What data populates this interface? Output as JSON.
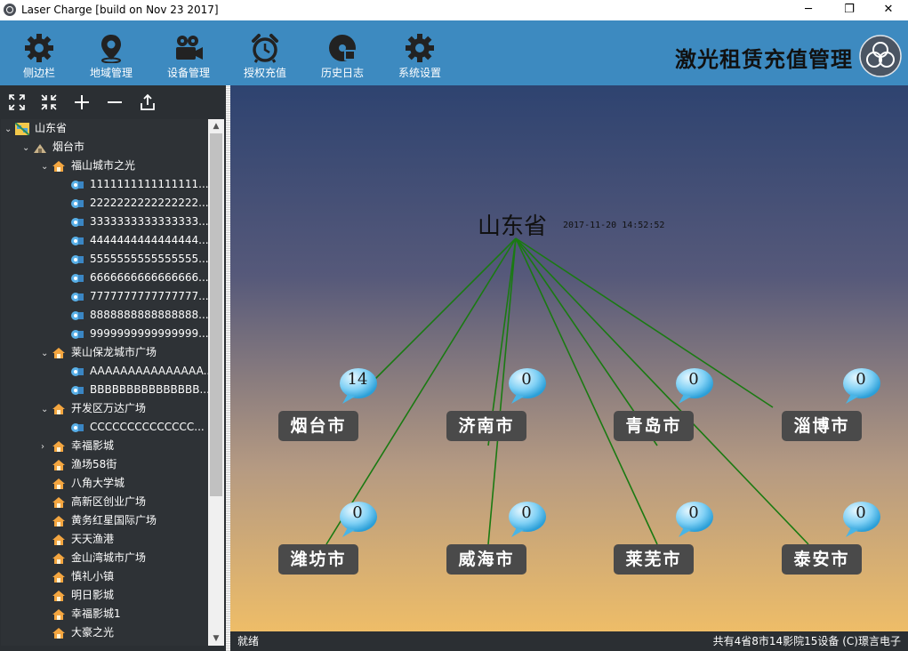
{
  "window": {
    "title": "Laser Charge [build on Nov 23 2017]",
    "controls": {
      "minimize": "─",
      "maximize": "❐",
      "close": "✕"
    }
  },
  "toolbar": {
    "items": [
      {
        "label": "侧边栏",
        "icon": "gear-icon"
      },
      {
        "label": "地域管理",
        "icon": "map-pin-icon"
      },
      {
        "label": "设备管理",
        "icon": "camera-icon"
      },
      {
        "label": "授权充值",
        "icon": "alarm-clock-icon"
      },
      {
        "label": "历史日志",
        "icon": "disc-icon"
      },
      {
        "label": "系统设置",
        "icon": "gear-icon"
      }
    ],
    "brand": "激光租赁充值管理",
    "brand_logo": "rings-logo-icon"
  },
  "sidebar": {
    "tools": [
      "expand-all-icon",
      "collapse-all-icon",
      "plus-icon",
      "minus-icon",
      "export-icon"
    ],
    "tree": [
      {
        "label": "山东省",
        "level": 0,
        "arrow": "⌄",
        "icon": "map-icon"
      },
      {
        "label": "烟台市",
        "level": 1,
        "arrow": "⌄",
        "icon": "city-icon"
      },
      {
        "label": "福山城市之光",
        "level": 2,
        "arrow": "⌄",
        "icon": "house-icon"
      },
      {
        "label": "1111111111111111...",
        "level": 3,
        "arrow": "",
        "icon": "device-icon"
      },
      {
        "label": "2222222222222222...",
        "level": 3,
        "arrow": "",
        "icon": "device-icon"
      },
      {
        "label": "3333333333333333...",
        "level": 3,
        "arrow": "",
        "icon": "device-icon"
      },
      {
        "label": "4444444444444444...",
        "level": 3,
        "arrow": "",
        "icon": "device-icon"
      },
      {
        "label": "5555555555555555...",
        "level": 3,
        "arrow": "",
        "icon": "device-icon"
      },
      {
        "label": "6666666666666666...",
        "level": 3,
        "arrow": "",
        "icon": "device-icon"
      },
      {
        "label": "7777777777777777...",
        "level": 3,
        "arrow": "",
        "icon": "device-icon"
      },
      {
        "label": "8888888888888888...",
        "level": 3,
        "arrow": "",
        "icon": "device-icon"
      },
      {
        "label": "9999999999999999...",
        "level": 3,
        "arrow": "",
        "icon": "device-icon"
      },
      {
        "label": "莱山保龙城市广场",
        "level": 2,
        "arrow": "⌄",
        "icon": "house-icon"
      },
      {
        "label": "AAAAAAAAAAAAAAA...",
        "level": 3,
        "arrow": "",
        "icon": "device-icon"
      },
      {
        "label": "BBBBBBBBBBBBBBB...",
        "level": 3,
        "arrow": "",
        "icon": "device-icon"
      },
      {
        "label": "开发区万达广场",
        "level": 2,
        "arrow": "⌄",
        "icon": "house-icon"
      },
      {
        "label": "CCCCCCCCCCCCCC...",
        "level": 3,
        "arrow": "",
        "icon": "device-icon"
      },
      {
        "label": "幸福影城",
        "level": 2,
        "arrow": "›",
        "icon": "house-icon"
      },
      {
        "label": "渔场58街",
        "level": 2,
        "arrow": "",
        "icon": "house-icon"
      },
      {
        "label": "八角大学城",
        "level": 2,
        "arrow": "",
        "icon": "house-icon"
      },
      {
        "label": "高新区创业广场",
        "level": 2,
        "arrow": "",
        "icon": "house-icon"
      },
      {
        "label": "黄务红星国际广场",
        "level": 2,
        "arrow": "",
        "icon": "house-icon"
      },
      {
        "label": "天天渔港",
        "level": 2,
        "arrow": "",
        "icon": "house-icon"
      },
      {
        "label": "金山湾城市广场",
        "level": 2,
        "arrow": "",
        "icon": "house-icon"
      },
      {
        "label": "慎礼小镇",
        "level": 2,
        "arrow": "",
        "icon": "house-icon"
      },
      {
        "label": "明日影城",
        "level": 2,
        "arrow": "",
        "icon": "house-icon"
      },
      {
        "label": "幸福影城1",
        "level": 2,
        "arrow": "",
        "icon": "house-icon"
      },
      {
        "label": "大豪之光",
        "level": 2,
        "arrow": "",
        "icon": "house-icon"
      }
    ]
  },
  "map": {
    "province": "山东省",
    "timestamp": "2017-11-20 14:52:52",
    "cities": [
      {
        "name": "烟台市",
        "count": "14"
      },
      {
        "name": "济南市",
        "count": "0"
      },
      {
        "name": "青岛市",
        "count": "0"
      },
      {
        "name": "淄博市",
        "count": "0"
      },
      {
        "name": "潍坊市",
        "count": "0"
      },
      {
        "name": "威海市",
        "count": "0"
      },
      {
        "name": "莱芜市",
        "count": "0"
      },
      {
        "name": "泰安市",
        "count": "0"
      }
    ],
    "line_color": "#1a7a12"
  },
  "status": {
    "left": "就绪",
    "right": "共有4省8市14影院15设备 (C)璟言电子"
  }
}
